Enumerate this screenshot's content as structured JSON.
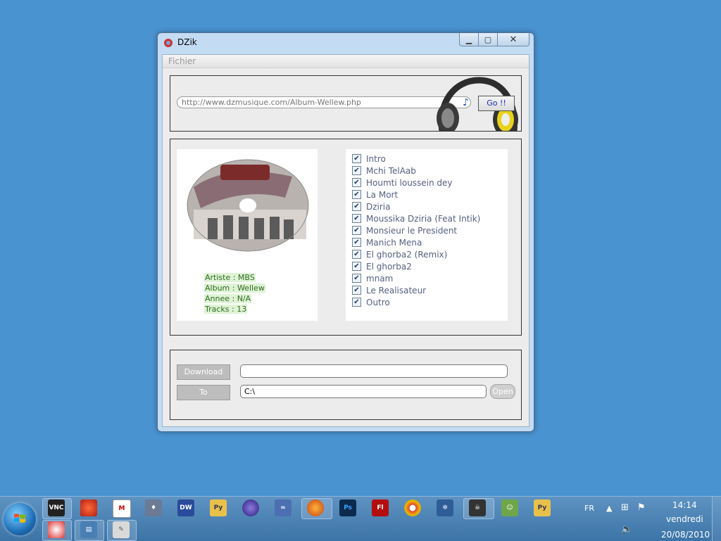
{
  "window": {
    "title": "DZik",
    "menu": [
      "Fichier"
    ]
  },
  "search": {
    "url_placeholder": "http://www.dzmusique.com/Album-Wellew.php",
    "go_label": "Go !!"
  },
  "album": {
    "info": [
      "Artiste : MBS",
      "Album : Wellew",
      "Annee : N/A",
      "Tracks : 13"
    ],
    "tracks": [
      "Intro",
      "Mchi TelAab",
      "Houmti loussein dey",
      "La Mort",
      "Dziria",
      "Moussika Dziria (Feat Intik)",
      "Monsieur le President",
      "Manich Mena",
      "El ghorba2 (Remix)",
      "El ghorba2",
      "mnam",
      "Le Realisateur",
      "Outro"
    ]
  },
  "download": {
    "download_label": "Download",
    "to_label": "To",
    "path_value": "C:\\",
    "open_label": "Open"
  },
  "taskbar": {
    "language": "FR",
    "time": "14:14",
    "day": "vendredi",
    "date": "20/08/2010"
  }
}
